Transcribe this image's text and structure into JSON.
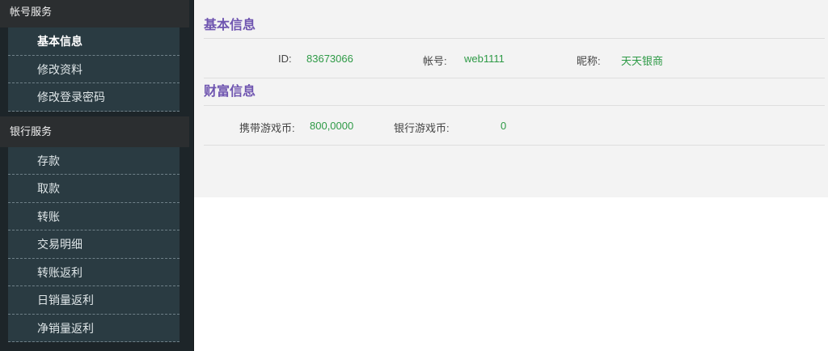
{
  "sidebar": {
    "account_group": {
      "title": "帐号服务",
      "items": [
        "基本信息",
        "修改资料",
        "修改登录密码"
      ]
    },
    "bank_group": {
      "title": "银行服务",
      "items": [
        "存款",
        "取款",
        "转账",
        "交易明细",
        "转账返利",
        "日销量返利",
        "净销量返利"
      ]
    }
  },
  "basic_info": {
    "title": "基本信息",
    "id_label": "ID:",
    "id_value": "83673066",
    "account_label": "帐号:",
    "account_value": "web1111",
    "nickname_label": "昵称:",
    "nickname_value": "天天银商"
  },
  "wealth_info": {
    "title": "财富信息",
    "carry_label": "携带游戏币:",
    "carry_value": "800,0000",
    "bank_label": "银行游戏币:",
    "bank_value": "0"
  }
}
